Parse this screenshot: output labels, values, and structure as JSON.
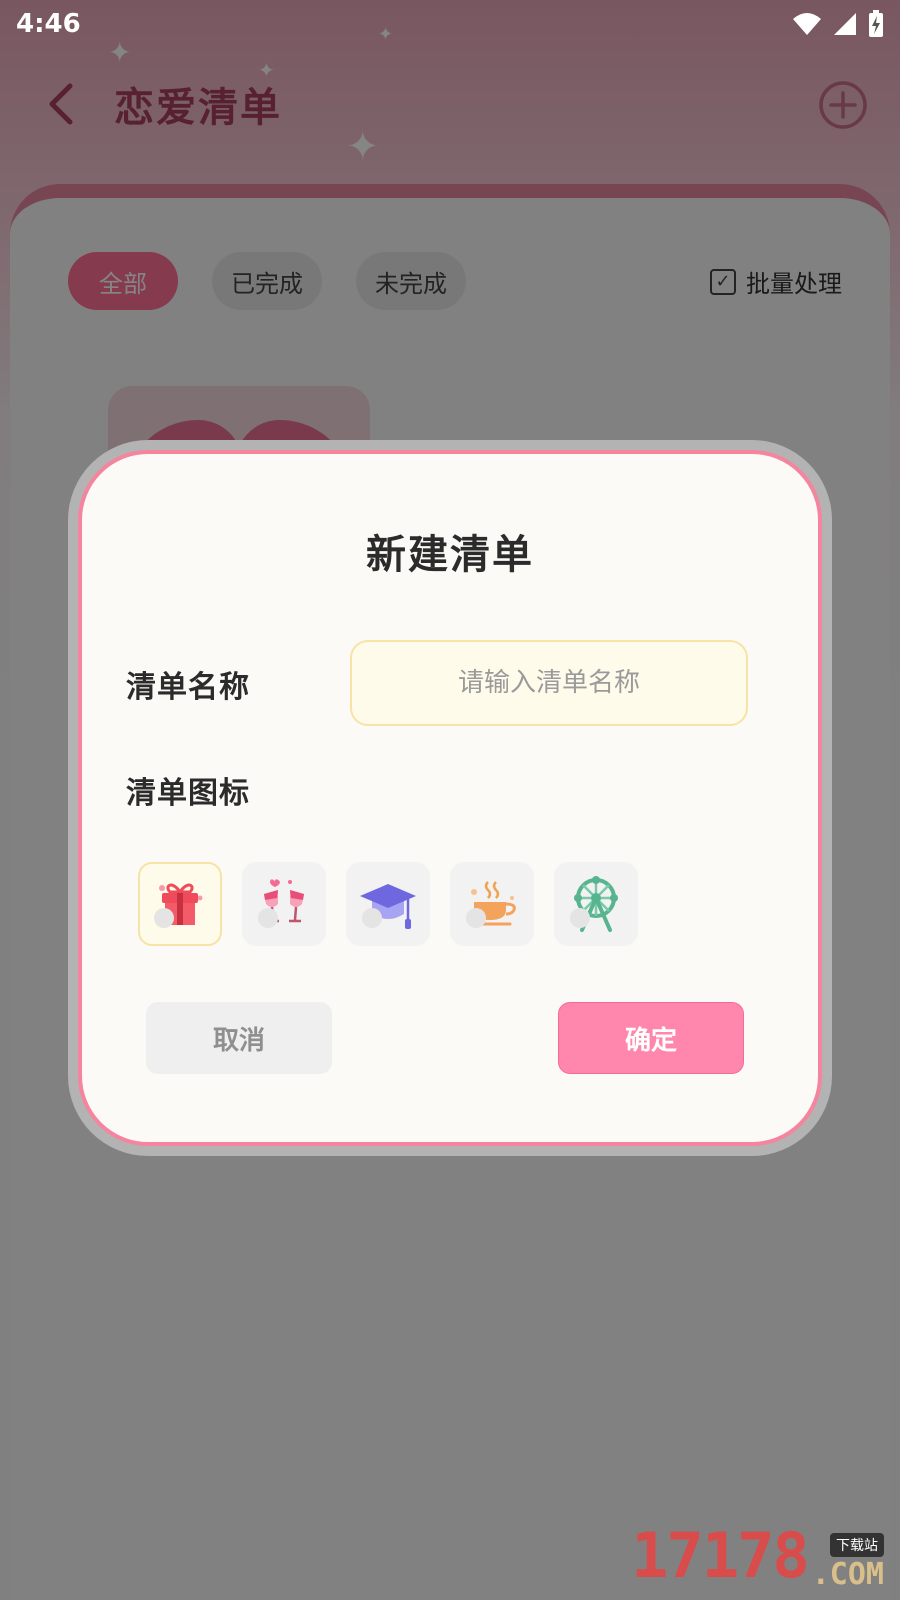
{
  "status_bar": {
    "time": "4:46"
  },
  "header": {
    "title": "恋爱清单"
  },
  "filters": [
    {
      "label": "全部",
      "active": true
    },
    {
      "label": "已完成",
      "active": false
    },
    {
      "label": "未完成",
      "active": false
    }
  ],
  "batch": {
    "label": "批量处理"
  },
  "dialog": {
    "title": "新建清单",
    "name_label": "清单名称",
    "name_placeholder": "请输入清单名称",
    "name_value": "",
    "icon_label": "清单图标",
    "icons": [
      "gift-icon",
      "toast-glasses-icon",
      "graduation-cap-icon",
      "coffee-cup-icon",
      "ferris-wheel-icon"
    ],
    "selected_icon": "gift-icon",
    "cancel_label": "取消",
    "confirm_label": "确定"
  },
  "watermark": {
    "number": "17178",
    "tag": "下载站",
    "domain": ".COM"
  },
  "colors": {
    "accent": "#ff87ad",
    "dialog_border": "#f5849f",
    "input_bg": "#fffbea"
  }
}
